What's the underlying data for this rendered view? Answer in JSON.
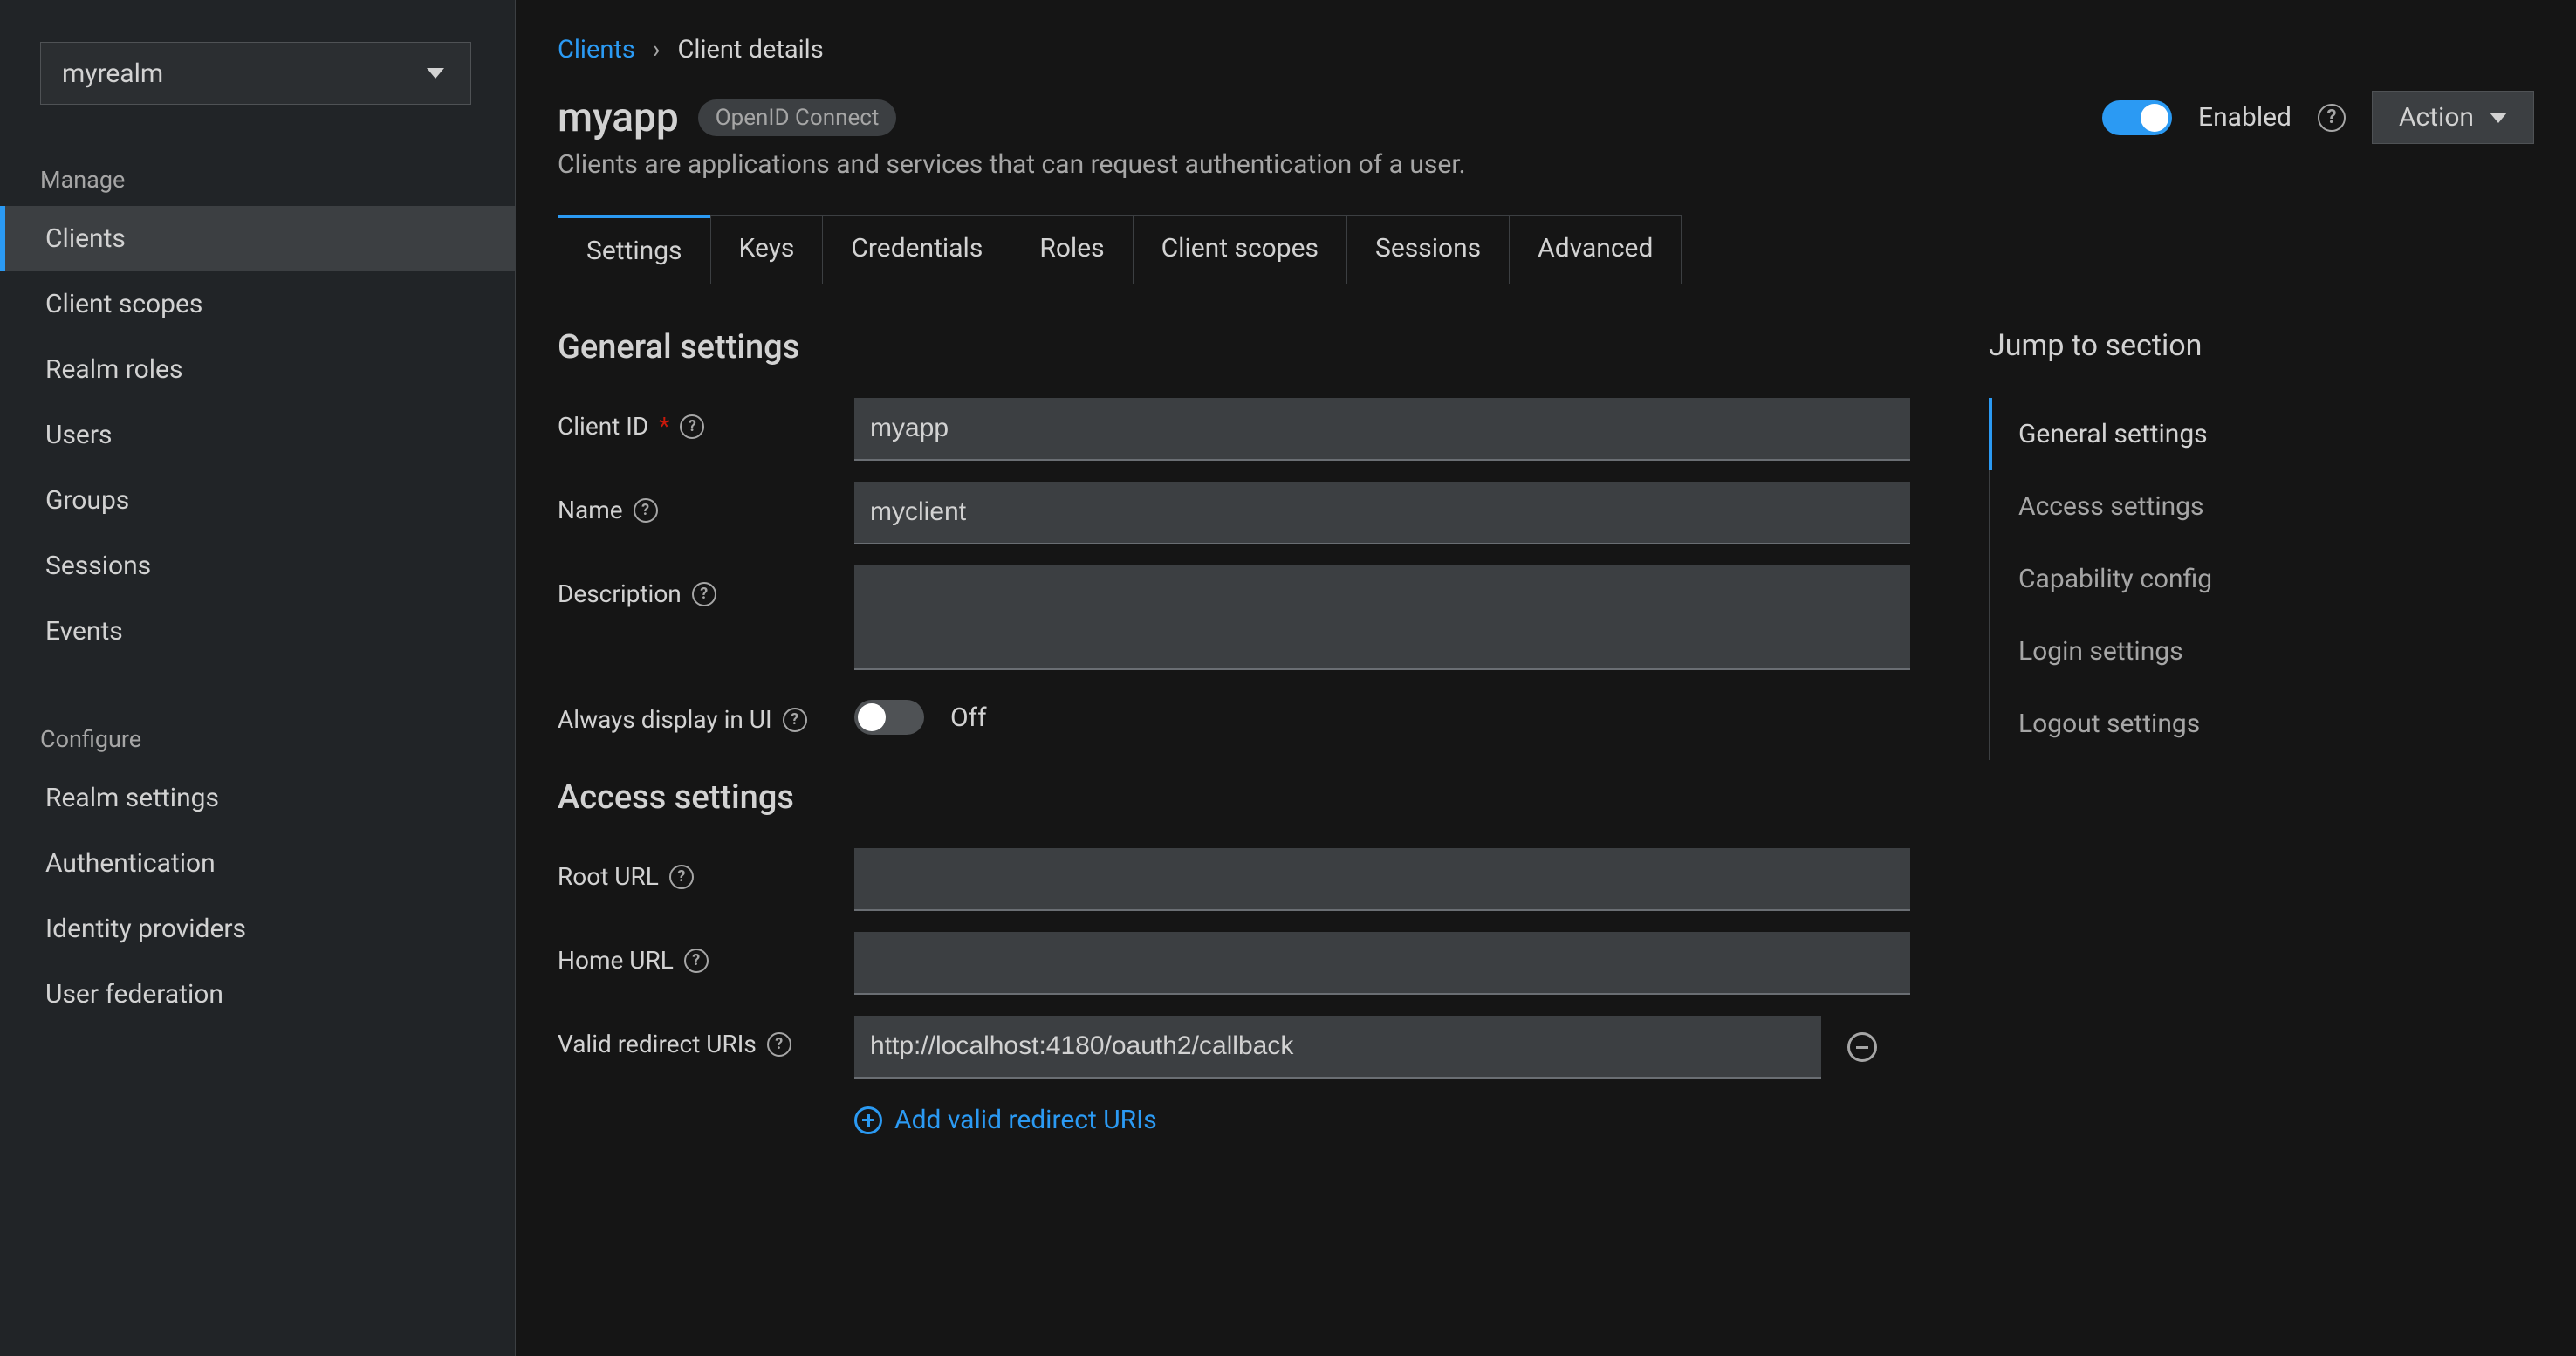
{
  "realm_selector": {
    "value": "myrealm"
  },
  "sidebar": {
    "manage_label": "Manage",
    "configure_label": "Configure",
    "manage_items": [
      {
        "key": "clients",
        "label": "Clients"
      },
      {
        "key": "client-scopes",
        "label": "Client scopes"
      },
      {
        "key": "realm-roles",
        "label": "Realm roles"
      },
      {
        "key": "users",
        "label": "Users"
      },
      {
        "key": "groups",
        "label": "Groups"
      },
      {
        "key": "sessions",
        "label": "Sessions"
      },
      {
        "key": "events",
        "label": "Events"
      }
    ],
    "configure_items": [
      {
        "key": "realm-settings",
        "label": "Realm settings"
      },
      {
        "key": "authentication",
        "label": "Authentication"
      },
      {
        "key": "identity-providers",
        "label": "Identity providers"
      },
      {
        "key": "user-federation",
        "label": "User federation"
      }
    ]
  },
  "breadcrumb": {
    "link": "Clients",
    "current": "Client details"
  },
  "header": {
    "title": "myapp",
    "badge": "OpenID Connect",
    "enabled_label": "Enabled",
    "action_label": "Action",
    "description": "Clients are applications and services that can request authentication of a user."
  },
  "tabs": [
    {
      "key": "settings",
      "label": "Settings"
    },
    {
      "key": "keys",
      "label": "Keys"
    },
    {
      "key": "credentials",
      "label": "Credentials"
    },
    {
      "key": "roles",
      "label": "Roles"
    },
    {
      "key": "client-scopes",
      "label": "Client scopes"
    },
    {
      "key": "sessions",
      "label": "Sessions"
    },
    {
      "key": "advanced",
      "label": "Advanced"
    }
  ],
  "form": {
    "general_title": "General settings",
    "access_title": "Access settings",
    "labels": {
      "client_id": "Client ID",
      "name": "Name",
      "description": "Description",
      "always_display": "Always display in UI",
      "root_url": "Root URL",
      "home_url": "Home URL",
      "valid_redirect": "Valid redirect URIs"
    },
    "values": {
      "client_id": "myapp",
      "name": "myclient",
      "description": "",
      "always_display_on": false,
      "always_display_text": "Off",
      "root_url": "",
      "home_url": "",
      "redirect_uri_0": "http://localhost:4180/oauth2/callback"
    },
    "add_redirect_label": "Add valid redirect URIs"
  },
  "jump": {
    "title": "Jump to section",
    "items": [
      {
        "key": "general",
        "label": "General settings"
      },
      {
        "key": "access",
        "label": "Access settings"
      },
      {
        "key": "capability",
        "label": "Capability config"
      },
      {
        "key": "login",
        "label": "Login settings"
      },
      {
        "key": "logout",
        "label": "Logout settings"
      }
    ]
  }
}
